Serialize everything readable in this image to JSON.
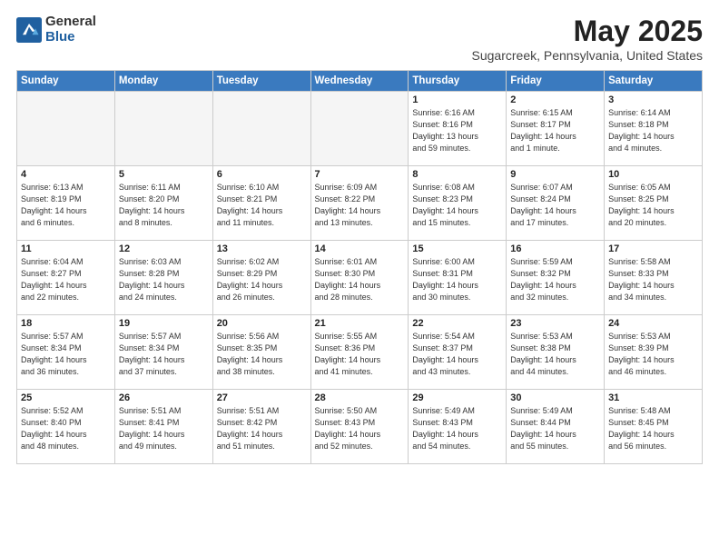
{
  "logo": {
    "general": "General",
    "blue": "Blue"
  },
  "header": {
    "title": "May 2025",
    "subtitle": "Sugarcreek, Pennsylvania, United States"
  },
  "weekdays": [
    "Sunday",
    "Monday",
    "Tuesday",
    "Wednesday",
    "Thursday",
    "Friday",
    "Saturday"
  ],
  "weeks": [
    [
      {
        "day": "",
        "info": ""
      },
      {
        "day": "",
        "info": ""
      },
      {
        "day": "",
        "info": ""
      },
      {
        "day": "",
        "info": ""
      },
      {
        "day": "1",
        "info": "Sunrise: 6:16 AM\nSunset: 8:16 PM\nDaylight: 13 hours\nand 59 minutes."
      },
      {
        "day": "2",
        "info": "Sunrise: 6:15 AM\nSunset: 8:17 PM\nDaylight: 14 hours\nand 1 minute."
      },
      {
        "day": "3",
        "info": "Sunrise: 6:14 AM\nSunset: 8:18 PM\nDaylight: 14 hours\nand 4 minutes."
      }
    ],
    [
      {
        "day": "4",
        "info": "Sunrise: 6:13 AM\nSunset: 8:19 PM\nDaylight: 14 hours\nand 6 minutes."
      },
      {
        "day": "5",
        "info": "Sunrise: 6:11 AM\nSunset: 8:20 PM\nDaylight: 14 hours\nand 8 minutes."
      },
      {
        "day": "6",
        "info": "Sunrise: 6:10 AM\nSunset: 8:21 PM\nDaylight: 14 hours\nand 11 minutes."
      },
      {
        "day": "7",
        "info": "Sunrise: 6:09 AM\nSunset: 8:22 PM\nDaylight: 14 hours\nand 13 minutes."
      },
      {
        "day": "8",
        "info": "Sunrise: 6:08 AM\nSunset: 8:23 PM\nDaylight: 14 hours\nand 15 minutes."
      },
      {
        "day": "9",
        "info": "Sunrise: 6:07 AM\nSunset: 8:24 PM\nDaylight: 14 hours\nand 17 minutes."
      },
      {
        "day": "10",
        "info": "Sunrise: 6:05 AM\nSunset: 8:25 PM\nDaylight: 14 hours\nand 20 minutes."
      }
    ],
    [
      {
        "day": "11",
        "info": "Sunrise: 6:04 AM\nSunset: 8:27 PM\nDaylight: 14 hours\nand 22 minutes."
      },
      {
        "day": "12",
        "info": "Sunrise: 6:03 AM\nSunset: 8:28 PM\nDaylight: 14 hours\nand 24 minutes."
      },
      {
        "day": "13",
        "info": "Sunrise: 6:02 AM\nSunset: 8:29 PM\nDaylight: 14 hours\nand 26 minutes."
      },
      {
        "day": "14",
        "info": "Sunrise: 6:01 AM\nSunset: 8:30 PM\nDaylight: 14 hours\nand 28 minutes."
      },
      {
        "day": "15",
        "info": "Sunrise: 6:00 AM\nSunset: 8:31 PM\nDaylight: 14 hours\nand 30 minutes."
      },
      {
        "day": "16",
        "info": "Sunrise: 5:59 AM\nSunset: 8:32 PM\nDaylight: 14 hours\nand 32 minutes."
      },
      {
        "day": "17",
        "info": "Sunrise: 5:58 AM\nSunset: 8:33 PM\nDaylight: 14 hours\nand 34 minutes."
      }
    ],
    [
      {
        "day": "18",
        "info": "Sunrise: 5:57 AM\nSunset: 8:34 PM\nDaylight: 14 hours\nand 36 minutes."
      },
      {
        "day": "19",
        "info": "Sunrise: 5:57 AM\nSunset: 8:34 PM\nDaylight: 14 hours\nand 37 minutes."
      },
      {
        "day": "20",
        "info": "Sunrise: 5:56 AM\nSunset: 8:35 PM\nDaylight: 14 hours\nand 38 minutes."
      },
      {
        "day": "21",
        "info": "Sunrise: 5:55 AM\nSunset: 8:36 PM\nDaylight: 14 hours\nand 41 minutes."
      },
      {
        "day": "22",
        "info": "Sunrise: 5:54 AM\nSunset: 8:37 PM\nDaylight: 14 hours\nand 43 minutes."
      },
      {
        "day": "23",
        "info": "Sunrise: 5:53 AM\nSunset: 8:38 PM\nDaylight: 14 hours\nand 44 minutes."
      },
      {
        "day": "24",
        "info": "Sunrise: 5:53 AM\nSunset: 8:39 PM\nDaylight: 14 hours\nand 46 minutes."
      }
    ],
    [
      {
        "day": "25",
        "info": "Sunrise: 5:52 AM\nSunset: 8:40 PM\nDaylight: 14 hours\nand 48 minutes."
      },
      {
        "day": "26",
        "info": "Sunrise: 5:51 AM\nSunset: 8:41 PM\nDaylight: 14 hours\nand 49 minutes."
      },
      {
        "day": "27",
        "info": "Sunrise: 5:51 AM\nSunset: 8:42 PM\nDaylight: 14 hours\nand 51 minutes."
      },
      {
        "day": "28",
        "info": "Sunrise: 5:50 AM\nSunset: 8:43 PM\nDaylight: 14 hours\nand 52 minutes."
      },
      {
        "day": "29",
        "info": "Sunrise: 5:49 AM\nSunset: 8:43 PM\nDaylight: 14 hours\nand 54 minutes."
      },
      {
        "day": "30",
        "info": "Sunrise: 5:49 AM\nSunset: 8:44 PM\nDaylight: 14 hours\nand 55 minutes."
      },
      {
        "day": "31",
        "info": "Sunrise: 5:48 AM\nSunset: 8:45 PM\nDaylight: 14 hours\nand 56 minutes."
      }
    ]
  ]
}
